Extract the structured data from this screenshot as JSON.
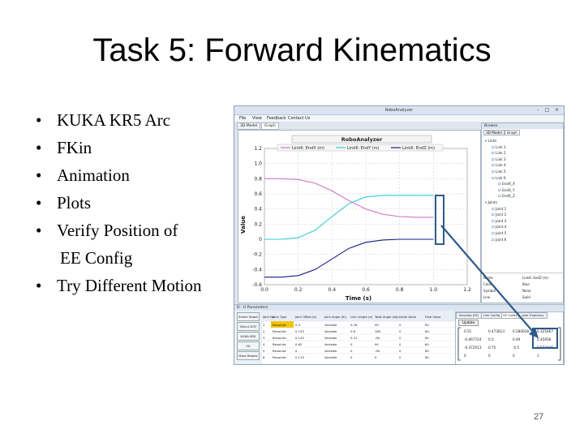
{
  "slide": {
    "title": "Task 5: Forward Kinematics",
    "bullets": [
      "KUKA KR5 Arc",
      "FKin",
      "Animation",
      "Plots",
      "Verify Position of"
    ],
    "bullet_continuation": "EE Config",
    "bullet_last": "Try Different Motion",
    "bullet_symbol": "•",
    "page_number": "27"
  },
  "app": {
    "window_title": "RoboAnalyzer",
    "menu": [
      "File",
      "View",
      "Feedback",
      "Contact Us"
    ],
    "tabs": [
      "3D Model",
      "Graph"
    ],
    "right_panel": {
      "title": "Browse",
      "tabs": [
        "3D Model",
        "Graph"
      ],
      "tree": [
        "Links",
        "Link 1",
        "Link 2",
        "Link 3",
        "Link 4",
        "Link 5",
        "Link 6",
        "EndX_X",
        "EndX_Y",
        "EndX_Z",
        "Joints",
        "Joint 1",
        "Joint 2",
        "Joint 3",
        "Joint 4",
        "Joint 5",
        "Joint 6"
      ],
      "props": [
        [
          "Name",
          "Link6: EndZ (m)"
        ],
        [
          "Color",
          "Blue"
        ],
        [
          "Symbol",
          "None"
        ],
        [
          "Line",
          "Solid"
        ]
      ]
    },
    "bottom_panel": {
      "title": "D - H Parameters",
      "buttons": [
        "Select Robot",
        "Select DOF",
        "KUKA KR5",
        "OK",
        "More Robots"
      ],
      "columns": [
        "Joint No",
        "Joint Type",
        "Joint Offset (b)",
        "Joint Angle (th)",
        "Link Length (a)",
        "Twist Angle (alp)",
        "Initial Value",
        "Final Value"
      ],
      "rows": [
        [
          "1",
          "Revolute",
          "0.4",
          "Variable",
          "0.18",
          "90",
          "0",
          "60"
        ],
        [
          "2",
          "Revolute",
          "0.135",
          "Variable",
          "0.6",
          "180",
          "0",
          "60"
        ],
        [
          "3",
          "Revolute",
          "0.135",
          "Variable",
          "0.12",
          "-90",
          "0",
          "60"
        ],
        [
          "4",
          "Revolute",
          "0.62",
          "Variable",
          "0",
          "90",
          "0",
          "60"
        ],
        [
          "5",
          "Revolute",
          "0",
          "Variable",
          "0",
          "-90",
          "0",
          "60"
        ],
        [
          "6",
          "Revolute",
          "0.115",
          "Variable",
          "0",
          "0",
          "0",
          "60"
        ]
      ],
      "right_tabs": [
        "Visualize (EE)",
        "Link Config",
        "EE Config",
        "Joint Trajectory"
      ],
      "update_button": "Update",
      "matrix": [
        [
          "0.51",
          "0.473613",
          "0.580028",
          "0.325467"
        ],
        [
          "-0.667724",
          "0.5",
          "0.49",
          "0.45658"
        ],
        [
          "-0.472013",
          "0.75",
          "-0.5",
          "0.572415"
        ],
        [
          "0",
          "0",
          "0",
          "1"
        ]
      ]
    }
  },
  "chart_data": {
    "type": "line",
    "title": "RoboAnalyzer",
    "xlabel": "Time (s)",
    "ylabel": "Value",
    "xlim": [
      0,
      1.2
    ],
    "ylim": [
      -0.6,
      1.2
    ],
    "xticks": [
      "0.0",
      "0.2",
      "0.4",
      "0.6",
      "0.8",
      "1.0",
      "1.2"
    ],
    "yticks": [
      "1.2",
      "1.0",
      "0.8",
      "0.6",
      "0.4",
      "0.2",
      "0",
      "-0.2",
      "-0.4",
      "-0.6"
    ],
    "grid": true,
    "legend_position": "top",
    "series": [
      {
        "name": "Link6: EndX (m)",
        "color": "#cc77cc",
        "x": [
          0,
          0.1,
          0.2,
          0.3,
          0.4,
          0.5,
          0.6,
          0.7,
          0.8,
          0.9,
          1.0
        ],
        "y": [
          0.8,
          0.8,
          0.79,
          0.74,
          0.64,
          0.51,
          0.4,
          0.33,
          0.3,
          0.29,
          0.29
        ]
      },
      {
        "name": "Link6: EndY (m)",
        "color": "#33cccc",
        "x": [
          0,
          0.1,
          0.2,
          0.3,
          0.4,
          0.5,
          0.6,
          0.7,
          0.8,
          0.9,
          1.0
        ],
        "y": [
          0,
          0,
          0.02,
          0.12,
          0.3,
          0.47,
          0.56,
          0.58,
          0.58,
          0.58,
          0.58
        ]
      },
      {
        "name": "Link6: EndZ (m)",
        "color": "#1a1a8c",
        "x": [
          0,
          0.1,
          0.2,
          0.3,
          0.4,
          0.5,
          0.6,
          0.7,
          0.8,
          0.9,
          1.0
        ],
        "y": [
          -0.5,
          -0.5,
          -0.48,
          -0.4,
          -0.26,
          -0.12,
          -0.04,
          -0.01,
          0,
          0,
          0
        ]
      }
    ]
  }
}
